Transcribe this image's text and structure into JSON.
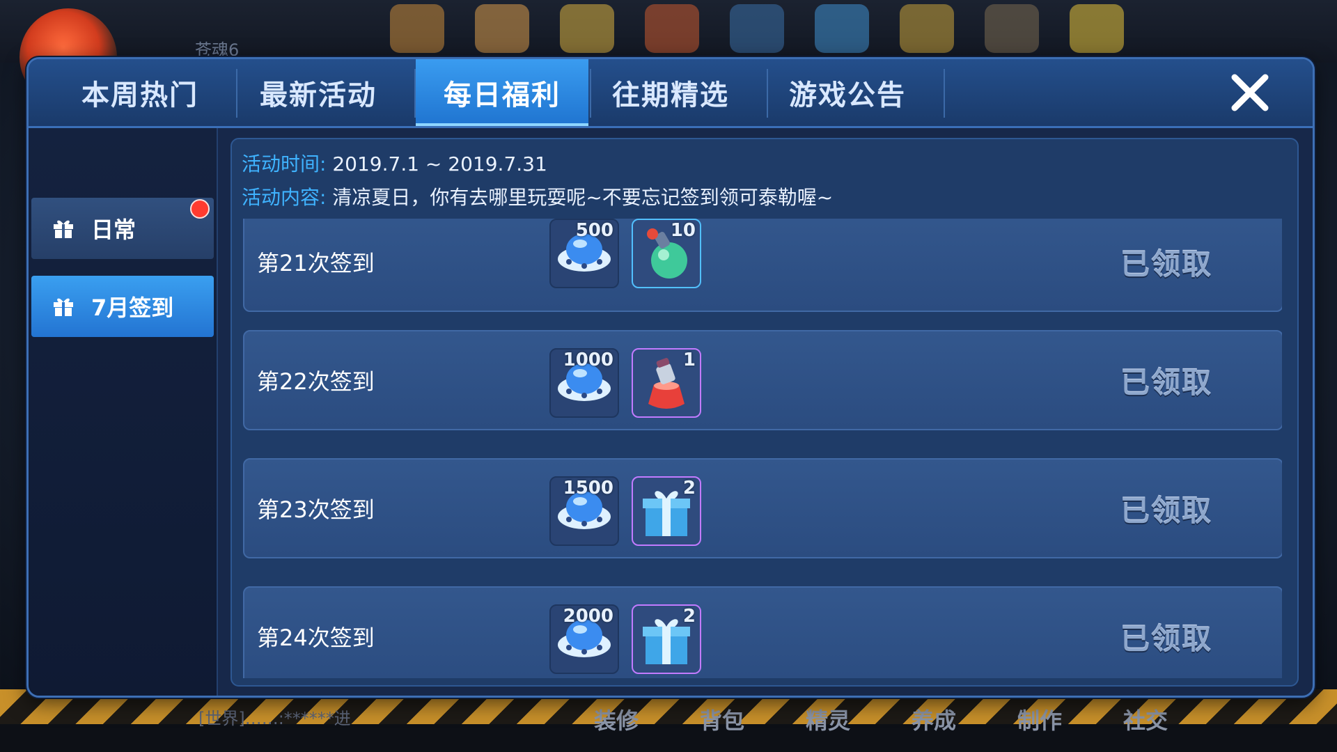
{
  "background": {
    "player_name": "苍魂6",
    "chat_line": "[世界]……:******进",
    "bottom_menu": [
      "装修",
      "背包",
      "精灵",
      "养成",
      "制作",
      "社交"
    ]
  },
  "tabs": [
    {
      "label": "本周热门",
      "active": false
    },
    {
      "label": "最新活动",
      "active": false
    },
    {
      "label": "每日福利",
      "active": true
    },
    {
      "label": "往期精选",
      "active": false
    },
    {
      "label": "游戏公告",
      "active": false
    }
  ],
  "sidebar": {
    "items": [
      {
        "label": "日常",
        "icon": "gift-icon",
        "active": false,
        "badge": true
      },
      {
        "label": "7月签到",
        "icon": "gift-icon",
        "active": true,
        "badge": false
      }
    ]
  },
  "event": {
    "time_label": "活动时间:",
    "time_value": "2019.7.1 ~ 2019.7.31",
    "content_label": "活动内容:",
    "content_value": "清凉夏日，你有去哪里玩耍呢~不要忘记签到领可泰勒喔~"
  },
  "checkins": [
    {
      "label": "第21次签到",
      "coin": "500",
      "item": "10",
      "item_icon": "green-potion-icon",
      "status": "已领取"
    },
    {
      "label": "第22次签到",
      "coin": "1000",
      "item": "1",
      "item_icon": "red-potion-icon",
      "status": "已领取"
    },
    {
      "label": "第23次签到",
      "coin": "1500",
      "item": "2",
      "item_icon": "gift-box-icon",
      "status": "已领取"
    },
    {
      "label": "第24次签到",
      "coin": "2000",
      "item": "2",
      "item_icon": "gift-box-icon",
      "status": "已领取"
    }
  ],
  "colors": {
    "accent": "#2f8ae6",
    "label_blue": "#3fb3ff",
    "badge_red": "#ff3b2f"
  }
}
